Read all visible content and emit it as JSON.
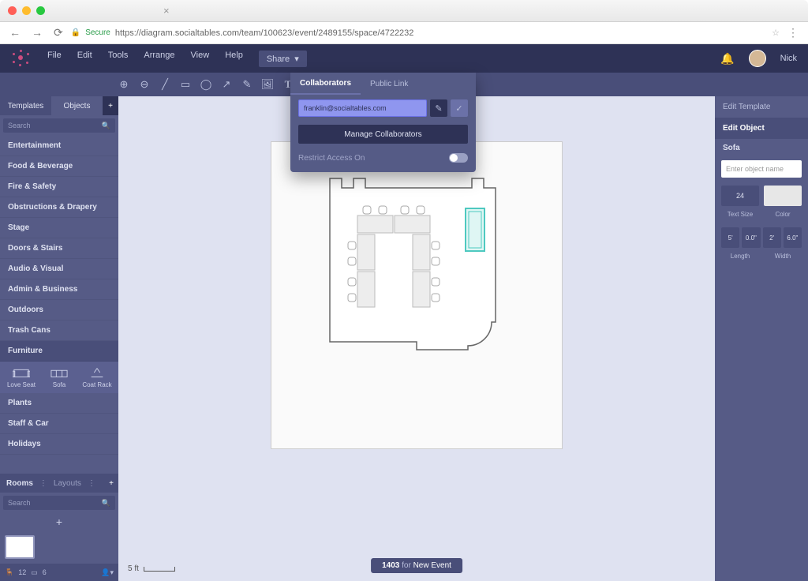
{
  "browser": {
    "url_secure": "Secure",
    "url": "https://diagram.socialtables.com/team/100623/event/2489155/space/4722232"
  },
  "menu": [
    "File",
    "Edit",
    "Tools",
    "Arrange",
    "View",
    "Help",
    "Share"
  ],
  "user": {
    "name": "Nick"
  },
  "share": {
    "tab_collaborators": "Collaborators",
    "tab_public": "Public Link",
    "email": "franklin@socialtables.com",
    "manage": "Manage Collaborators",
    "restrict": "Restrict Access On"
  },
  "left": {
    "tab_templates": "Templates",
    "tab_objects": "Objects",
    "search_placeholder": "Search",
    "categories": [
      "Entertainment",
      "Food & Beverage",
      "Fire & Safety",
      "Obstructions & Drapery",
      "Stage",
      "Doors & Stairs",
      "Audio & Visual",
      "Admin & Business",
      "Outdoors",
      "Trash Cans"
    ],
    "furniture_label": "Furniture",
    "furniture_items": [
      "Love Seat",
      "Sofa",
      "Coat Rack"
    ],
    "categories2": [
      "Plants",
      "Staff & Car",
      "Holidays"
    ],
    "tab_rooms": "Rooms",
    "tab_layouts": "Layouts",
    "count_12": "12",
    "count_6": "6"
  },
  "canvas": {
    "scale": "5 ft",
    "stat_num": "1403",
    "stat_for": "for",
    "stat_event": "New Event"
  },
  "right": {
    "tab_template": "Edit Template",
    "tab_object": "Edit Object",
    "selected": "Sofa",
    "placeholder": "Enter object name",
    "text_size_val": "24",
    "text_size_lbl": "Text Size",
    "color_lbl": "Color",
    "len1": "5'",
    "len2": "0.0\"",
    "wid1": "2'",
    "wid2": "6.0\"",
    "length_lbl": "Length",
    "width_lbl": "Width"
  }
}
